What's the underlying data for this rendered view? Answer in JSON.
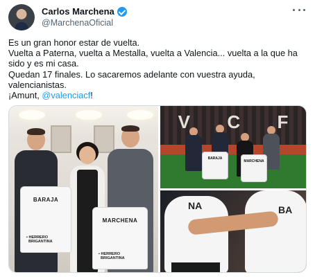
{
  "author": {
    "display_name": "Carlos Marchena",
    "handle": "@MarchenaOficial"
  },
  "tweet": {
    "lines": [
      "Es un gran honor estar de vuelta.",
      "Vuelta a Paterna, vuelta a Mestalla, vuelta a Valencia... vuelta a la que ha",
      "sido y es mi casa.",
      "Quedan 17 finales. Lo sacaremos adelante con vuestra ayuda,",
      "valencianistas."
    ],
    "last_line_prefix": "¡Amunt, ",
    "mention": "@valenciacf",
    "last_line_suffix": "!"
  },
  "media": {
    "photo1": {
      "shirt_left_name": "BARAJA",
      "shirt_right_name": "MARCHENA",
      "sponsor": "HERRERO\nBRIGANTINA"
    },
    "photo2": {
      "stand_letters": [
        "V",
        "C",
        "F"
      ],
      "shirt_left_name": "BARAJA",
      "shirt_right_name": "MARCHENA"
    },
    "photo3": {
      "jersey_text_left": "NA",
      "jersey_text_right": "BA"
    }
  },
  "colors": {
    "accent": "#1d9bf0",
    "text": "#0f1419",
    "secondary_text": "#536471"
  },
  "icons": [
    "verified-badge-icon",
    "more-options-icon"
  ]
}
